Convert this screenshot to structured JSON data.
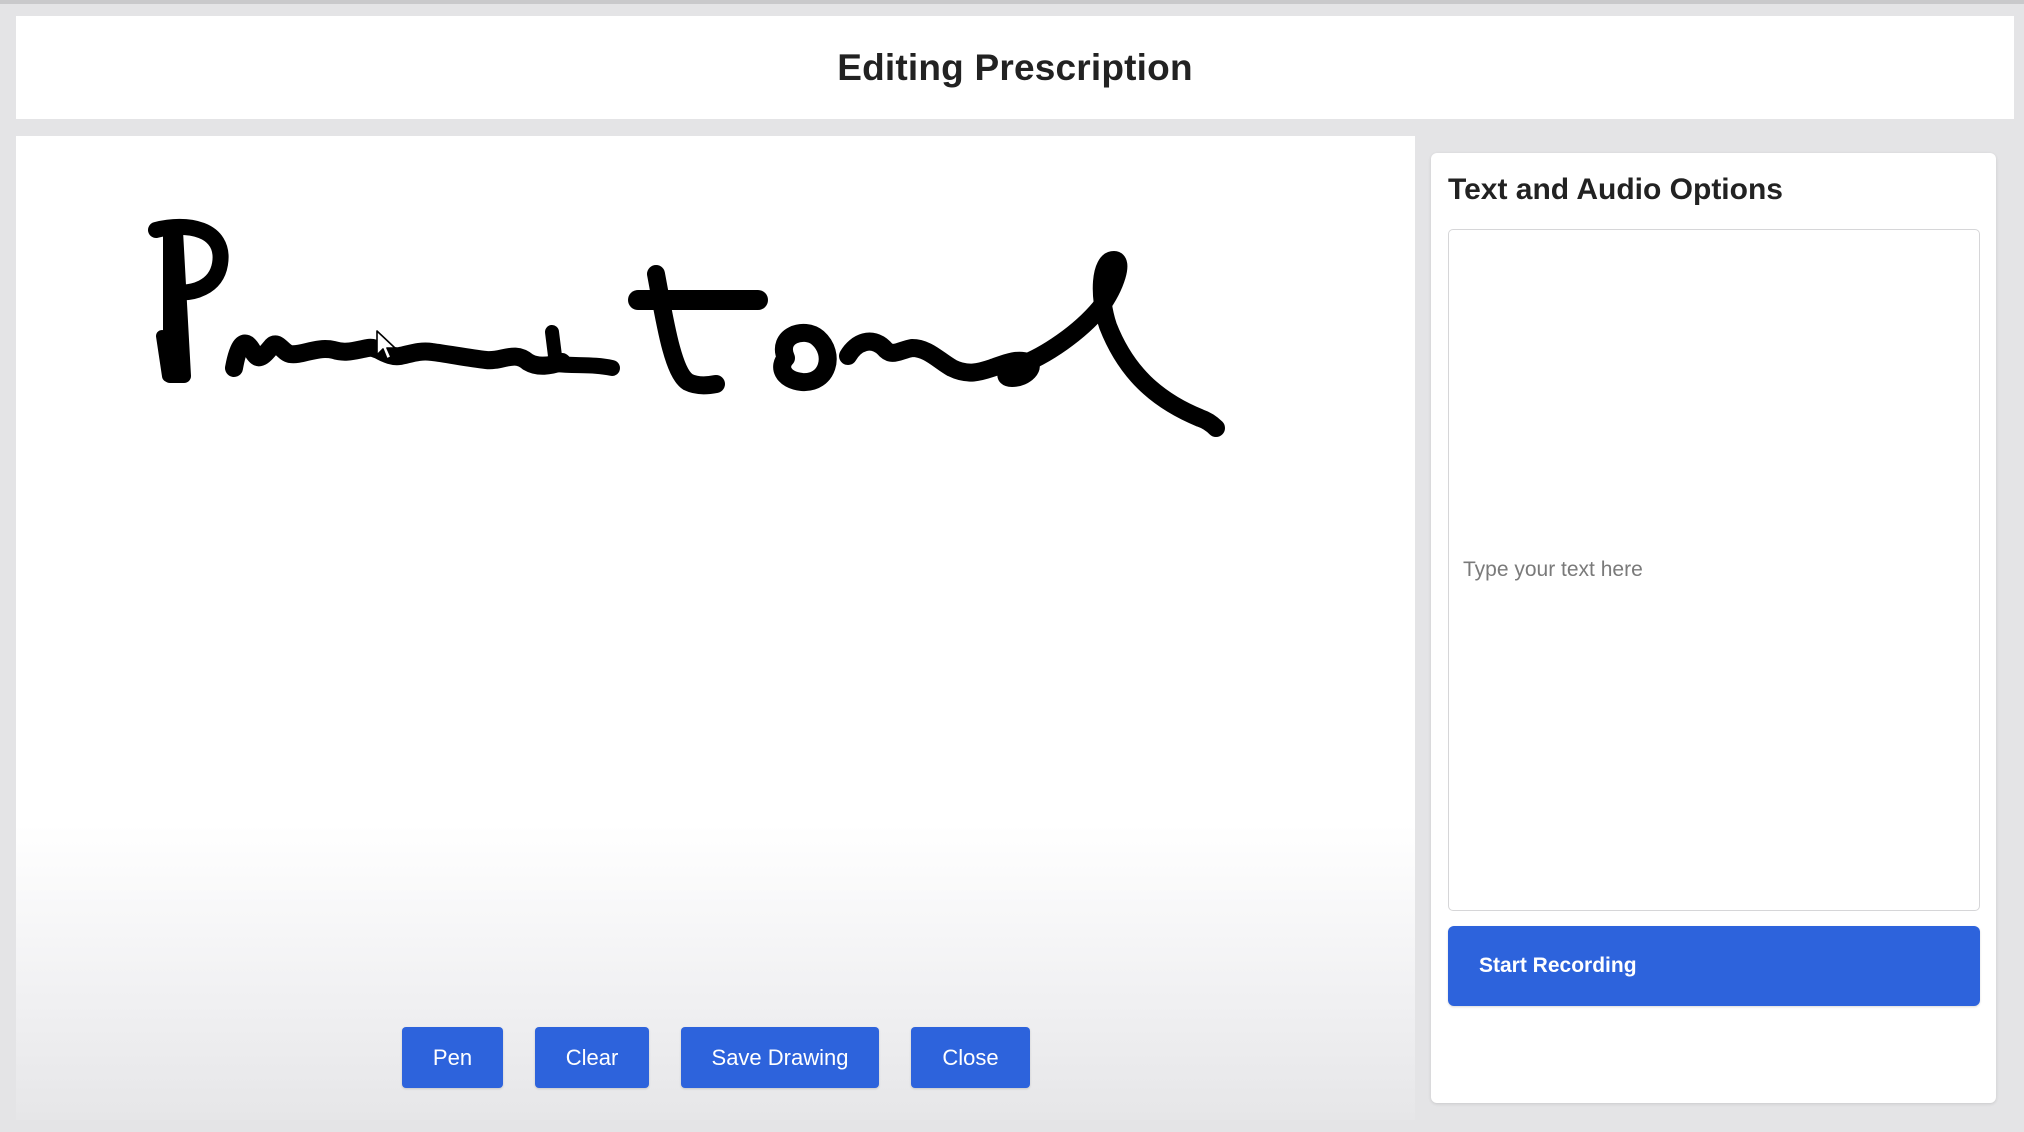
{
  "header": {
    "title": "Editing Prescription"
  },
  "toolbar": {
    "pen_label": "Pen",
    "clear_label": "Clear",
    "save_label": "Save Drawing",
    "close_label": "Close"
  },
  "sidebar": {
    "title": "Text and Audio Options",
    "text_input": {
      "value": "",
      "placeholder": "Type your text here"
    },
    "record_label": "Start Recording"
  },
  "colors": {
    "accent": "#2d63dc",
    "ink": "#000000",
    "background": "#e4e4e6"
  },
  "icons": {
    "cursor": "mouse-pointer-icon"
  }
}
